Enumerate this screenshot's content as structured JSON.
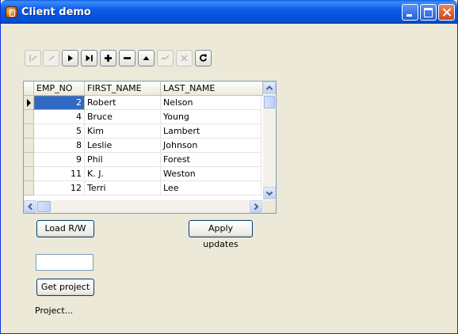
{
  "window": {
    "title": "Client demo"
  },
  "navigator": {
    "buttons": [
      {
        "name": "first-record-button",
        "icon": "first-icon",
        "enabled": false
      },
      {
        "name": "prior-record-button",
        "icon": "prior-icon",
        "enabled": false
      },
      {
        "name": "next-record-button",
        "icon": "next-icon",
        "enabled": true
      },
      {
        "name": "last-record-button",
        "icon": "last-icon",
        "enabled": true
      },
      {
        "name": "insert-record-button",
        "icon": "plus-icon",
        "enabled": true
      },
      {
        "name": "delete-record-button",
        "icon": "minus-icon",
        "enabled": true
      },
      {
        "name": "edit-record-button",
        "icon": "up-triangle-icon",
        "enabled": true
      },
      {
        "name": "post-record-button",
        "icon": "check-icon",
        "enabled": false
      },
      {
        "name": "cancel-record-button",
        "icon": "x-icon",
        "enabled": false
      },
      {
        "name": "refresh-button",
        "icon": "refresh-icon",
        "enabled": true
      }
    ]
  },
  "grid": {
    "columns": [
      "EMP_NO",
      "FIRST_NAME",
      "LAST_NAME"
    ],
    "rows": [
      [
        "2",
        "Robert",
        "Nelson"
      ],
      [
        "4",
        "Bruce",
        "Young"
      ],
      [
        "5",
        "Kim",
        "Lambert"
      ],
      [
        "8",
        "Leslie",
        "Johnson"
      ],
      [
        "9",
        "Phil",
        "Forest"
      ],
      [
        "11",
        "K. J.",
        "Weston"
      ],
      [
        "12",
        "Terri",
        "Lee"
      ]
    ],
    "selected_row": 0
  },
  "buttons": {
    "load_label": "Load R/W",
    "apply_label": "Apply updates",
    "get_project_label": "Get project"
  },
  "project_input": {
    "value": ""
  },
  "status": {
    "project_label": "Project..."
  },
  "colors": {
    "title_bar": "#0d5ce8",
    "selection": "#316ac5",
    "face": "#ece9d8"
  }
}
